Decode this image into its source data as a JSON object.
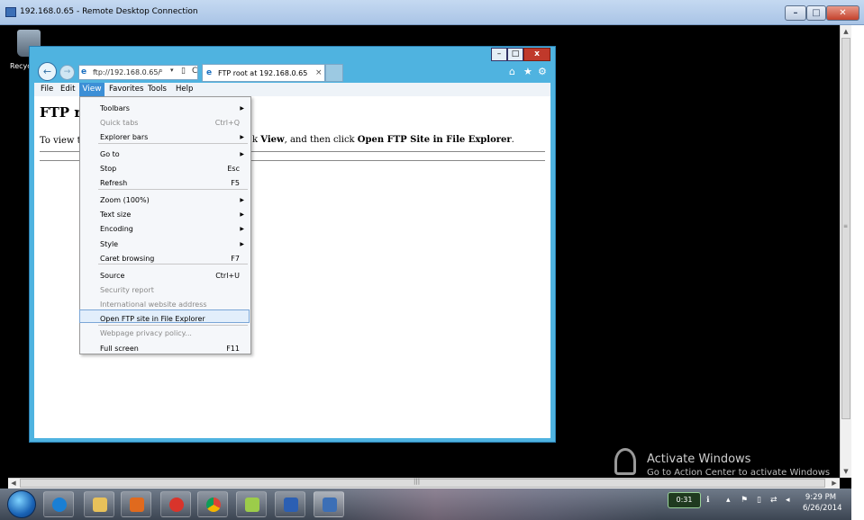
{
  "rdp": {
    "title": "192.168.0.65 - Remote Desktop Connection",
    "minimize": "–",
    "maximize": "□",
    "close": "✕"
  },
  "desktop": {
    "recycle_label": "Recyc",
    "activate_title": "Activate Windows",
    "activate_sub": "Go to Action Center to activate Windows"
  },
  "ie": {
    "address": "ftp://192.168.0.65/",
    "tab_title": "FTP root at 192.168.0.65",
    "tab_close": "×",
    "back": "←",
    "forward": "→",
    "search_glyph": "⌕",
    "dd_glyph": "▾",
    "compat_glyph": "▯",
    "refresh_glyph": "C",
    "ie_glyph": "e",
    "home_glyph": "⌂",
    "fav_glyph": "★",
    "gear_glyph": "⚙",
    "win_min": "–",
    "win_max": "□",
    "win_close": "x"
  },
  "menubar": [
    "File",
    "Edit",
    "View",
    "Favorites",
    "Tools",
    "Help"
  ],
  "content": {
    "heading_start": "FTP r",
    "para_start": "To view tl",
    "para_k": "k ",
    "para_view": "View",
    "para_mid": ", and then click ",
    "para_open": "Open FTP Site in File Explorer",
    "para_end": "."
  },
  "view_menu": {
    "items": [
      {
        "label": "Toolbars",
        "shortcut": "",
        "submenu": true,
        "disabled": false
      },
      {
        "label": "Quick tabs",
        "shortcut": "Ctrl+Q",
        "submenu": false,
        "disabled": true
      },
      {
        "label": "Explorer bars",
        "shortcut": "",
        "submenu": true,
        "disabled": false
      },
      {
        "label": "Go to",
        "shortcut": "",
        "submenu": true,
        "disabled": false
      },
      {
        "label": "Stop",
        "shortcut": "Esc",
        "submenu": false,
        "disabled": false
      },
      {
        "label": "Refresh",
        "shortcut": "F5",
        "submenu": false,
        "disabled": false
      },
      {
        "label": "Zoom (100%)",
        "shortcut": "",
        "submenu": true,
        "disabled": false
      },
      {
        "label": "Text size",
        "shortcut": "",
        "submenu": true,
        "disabled": false
      },
      {
        "label": "Encoding",
        "shortcut": "",
        "submenu": true,
        "disabled": false
      },
      {
        "label": "Style",
        "shortcut": "",
        "submenu": true,
        "disabled": false
      },
      {
        "label": "Caret browsing",
        "shortcut": "F7",
        "submenu": false,
        "disabled": false
      },
      {
        "label": "Source",
        "shortcut": "Ctrl+U",
        "submenu": false,
        "disabled": false
      },
      {
        "label": "Security report",
        "shortcut": "",
        "submenu": false,
        "disabled": true
      },
      {
        "label": "International website address",
        "shortcut": "",
        "submenu": false,
        "disabled": true
      },
      {
        "label": "Open FTP site in File Explorer",
        "shortcut": "",
        "submenu": false,
        "disabled": false,
        "highlighted": true
      },
      {
        "label": "Webpage privacy policy...",
        "shortcut": "",
        "submenu": false,
        "disabled": true
      },
      {
        "label": "Full screen",
        "shortcut": "F11",
        "submenu": false,
        "disabled": false
      }
    ],
    "arrow_glyph": "▶"
  },
  "scrollbars": {
    "up": "▲",
    "down": "▼",
    "left": "◀",
    "right": "▶",
    "grip_v": "≡",
    "grip_h": "|||"
  },
  "taskbar": {
    "apps": [
      "internet-explorer-icon",
      "file-explorer-icon",
      "media-player-icon",
      "recorder-icon",
      "chrome-icon",
      "notepad-icon",
      "word-icon",
      "remote-desktop-icon"
    ],
    "badge": "0:31",
    "info_glyph": "ℹ",
    "caret_glyph": "▴",
    "flag_glyph": "⚑",
    "battery_glyph": "▯",
    "network_glyph": "⇄",
    "volume_glyph": "◂",
    "time": "9:29 PM",
    "date": "6/26/2014"
  }
}
